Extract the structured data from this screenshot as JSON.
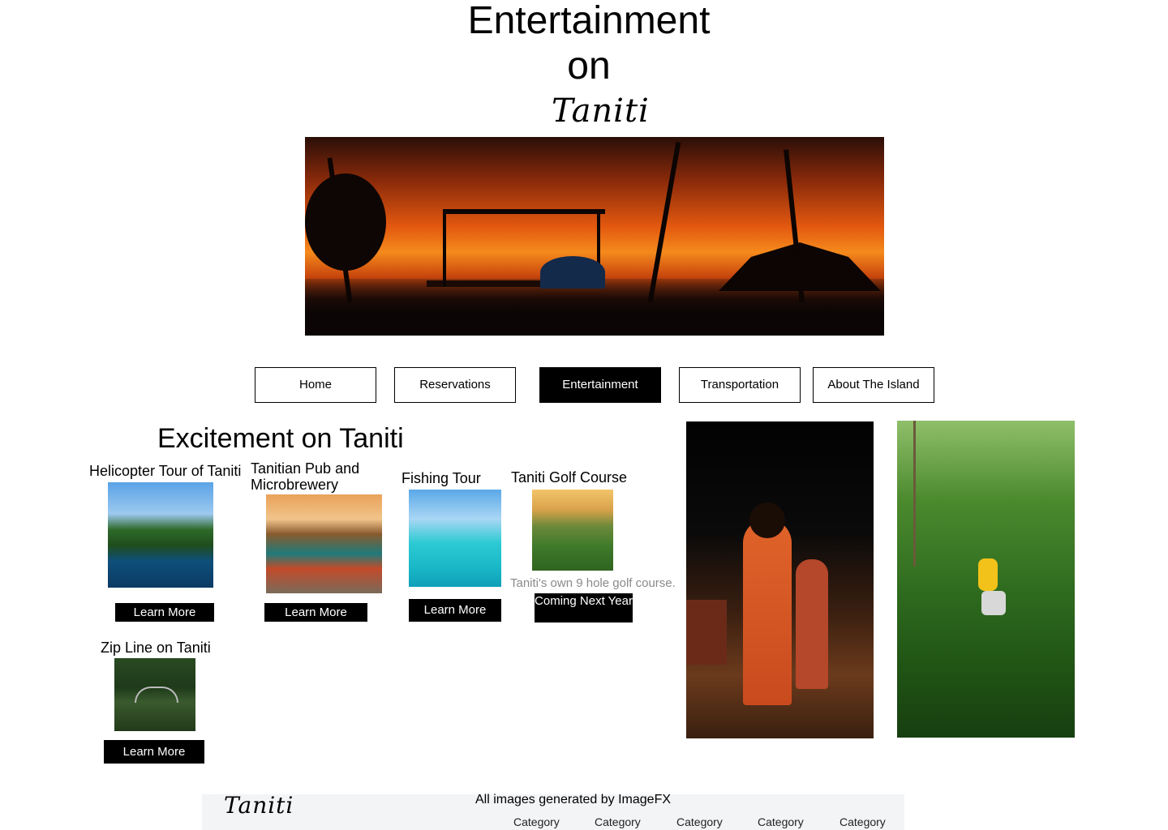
{
  "header": {
    "title_line1": "Entertainment",
    "title_line2": "on",
    "logo_text": "Taniti"
  },
  "nav": {
    "items": [
      {
        "label": "Home"
      },
      {
        "label": "Reservations"
      },
      {
        "label": "Entertainment",
        "active": true
      },
      {
        "label": "Transportation"
      },
      {
        "label": "About The Island"
      }
    ]
  },
  "main": {
    "section_title": "Excitement on Taniti",
    "cards": [
      {
        "title": "Helicopter Tour of Taniti",
        "button": "Learn More"
      },
      {
        "title": "Tanitian Pub and Microbrewery",
        "button": "Learn More"
      },
      {
        "title": "Fishing Tour",
        "button": "Learn More"
      },
      {
        "title": "Taniti Golf Course",
        "caption": "Taniti's own 9 hole golf course.",
        "button": "Coming Next Year"
      },
      {
        "title": "Zip Line on Taniti",
        "button": "Learn More"
      }
    ]
  },
  "footer": {
    "logo_text": "Taniti",
    "credit": "All images generated by ImageFX",
    "categories": [
      "Category",
      "Category",
      "Category",
      "Category",
      "Category"
    ]
  },
  "colors": {
    "accent": "#000000",
    "footer_bg": "#f3f4f6",
    "caption": "#8a8a8a"
  }
}
